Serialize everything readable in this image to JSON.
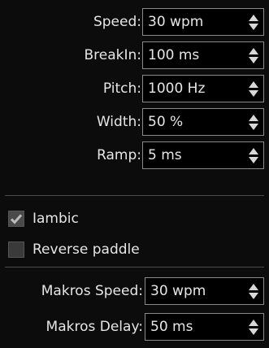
{
  "settings": [
    {
      "label": "Speed:",
      "value": "30 wpm"
    },
    {
      "label": "BreakIn:",
      "value": "100 ms"
    },
    {
      "label": "Pitch:",
      "value": "1000 Hz"
    },
    {
      "label": "Width:",
      "value": "50 %"
    },
    {
      "label": "Ramp:",
      "value": "5 ms"
    }
  ],
  "checkboxes": [
    {
      "label": "Iambic",
      "checked": true
    },
    {
      "label": "Reverse paddle",
      "checked": false
    }
  ],
  "makros": [
    {
      "label": "Makros Speed:",
      "value": "30 wpm"
    },
    {
      "label": "Makros Delay:",
      "value": "50 ms"
    }
  ],
  "icons": {
    "spin_up": "up-arrow-icon",
    "spin_down": "down-arrow-icon",
    "check": "checkmark-icon"
  },
  "colors": {
    "background": "#0c0c0c",
    "text": "#e6e6e6",
    "field_border": "#8a8a8a"
  }
}
